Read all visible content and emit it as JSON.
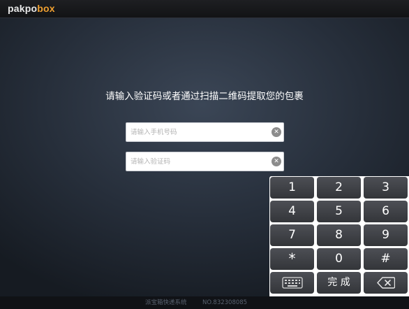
{
  "brand": {
    "part1": "pakpo",
    "part2": "box",
    "accent_color": "#f0a030"
  },
  "instruction": "请输入验证码或者通过扫描二维码提取您的包裹",
  "phone_field": {
    "value": "",
    "placeholder": "请输入手机号码",
    "clear_icon": "clear-circle-icon"
  },
  "code_field": {
    "value": "",
    "placeholder": "请输入验证码",
    "clear_icon": "clear-circle-icon"
  },
  "keypad": {
    "keys": [
      "1",
      "2",
      "3",
      "4",
      "5",
      "6",
      "7",
      "8",
      "9",
      "*",
      "0",
      "#"
    ],
    "keyboard_icon": "keyboard-icon",
    "done_label": "完 成",
    "backspace_icon": "backspace-icon"
  },
  "footer": {
    "system_name": "派宝箱快递系统",
    "number": "NO.832308085"
  }
}
